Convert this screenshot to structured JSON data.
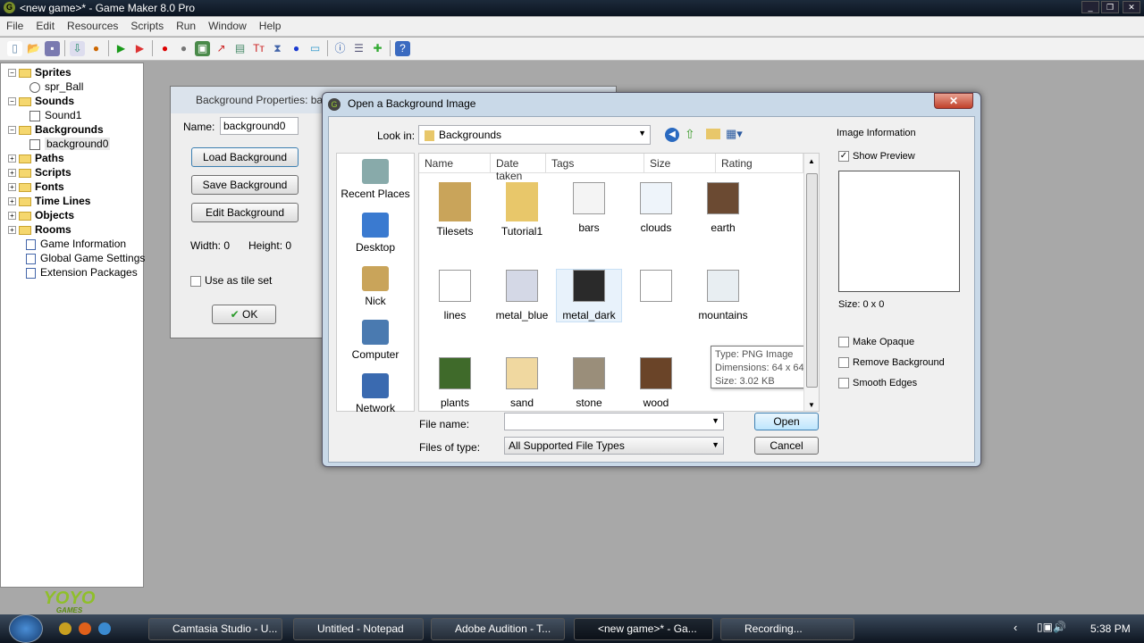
{
  "window": {
    "title": "<new game>* - Game Maker 8.0 Pro"
  },
  "menu": [
    "File",
    "Edit",
    "Resources",
    "Scripts",
    "Run",
    "Window",
    "Help"
  ],
  "toolbar": [
    "new-file",
    "open-file",
    "save",
    "create-executable",
    "publish",
    "run",
    "run-debug",
    "add-sprite",
    "add-sound",
    "add-background",
    "add-path",
    "add-script",
    "add-font",
    "add-timeline",
    "add-object",
    "add-room",
    "game-information",
    "global-settings",
    "extension-packages",
    "help"
  ],
  "tree": [
    {
      "label": "Sprites",
      "bold": true,
      "level": 0
    },
    {
      "label": "spr_Ball",
      "bold": false,
      "level": 1
    },
    {
      "label": "Sounds",
      "bold": true,
      "level": 0
    },
    {
      "label": "Sound1",
      "bold": false,
      "level": 1
    },
    {
      "label": "Backgrounds",
      "bold": true,
      "level": 0
    },
    {
      "label": "background0",
      "bold": false,
      "level": 1,
      "selected": true
    },
    {
      "label": "Paths",
      "bold": true,
      "level": 0
    },
    {
      "label": "Scripts",
      "bold": true,
      "level": 0
    },
    {
      "label": "Fonts",
      "bold": true,
      "level": 0
    },
    {
      "label": "Time Lines",
      "bold": true,
      "level": 0
    },
    {
      "label": "Objects",
      "bold": true,
      "level": 0
    },
    {
      "label": "Rooms",
      "bold": true,
      "level": 0
    },
    {
      "label": "Game Information",
      "bold": false,
      "level": 0
    },
    {
      "label": "Global Game Settings",
      "bold": false,
      "level": 0
    },
    {
      "label": "Extension Packages",
      "bold": false,
      "level": 0
    }
  ],
  "logo": {
    "text": "YOYO",
    "sub": "GAMES"
  },
  "bgprops": {
    "title": "Background Properties: ba",
    "name_label": "Name:",
    "name_value": "background0",
    "load": "Load Background",
    "save": "Save Background",
    "edit": "Edit Background",
    "width": "Width: 0",
    "height": "Height: 0",
    "tileset": "Use as tile set",
    "ok": "OK"
  },
  "dialog": {
    "title": "Open a Background Image",
    "look_in_label": "Look in:",
    "look_in_value": "Backgrounds",
    "places": [
      "Recent Places",
      "Desktop",
      "Nick",
      "Computer",
      "Network"
    ],
    "columns": [
      "Name",
      "Date taken",
      "Tags",
      "Size",
      "Rating"
    ],
    "items": [
      {
        "name": "Tilesets",
        "color": "#c9a45a"
      },
      {
        "name": "Tutorial1",
        "color": "#e8c76a"
      },
      {
        "name": "bars",
        "color": "#f4f4f4"
      },
      {
        "name": "clouds",
        "color": "#eef4fa"
      },
      {
        "name": "earth",
        "color": "#6b4a32"
      },
      {
        "name": "lines",
        "color": "#ffffff"
      },
      {
        "name": "metal_blue",
        "color": "#d4d8e6"
      },
      {
        "name": "metal_dark",
        "color": "#2a2a2a"
      },
      {
        "name": "",
        "color": "#ffffff"
      },
      {
        "name": "mountains",
        "color": "#e8eef2"
      },
      {
        "name": "plants",
        "color": "#3f6a2a"
      },
      {
        "name": "sand",
        "color": "#f0d8a0"
      },
      {
        "name": "stone",
        "color": "#9a8e7a"
      },
      {
        "name": "wood",
        "color": "#6a4428"
      }
    ],
    "tooltip": [
      "Type: PNG Image",
      "Dimensions: 64 x 64",
      "Size: 3.02 KB"
    ],
    "file_name_label": "File name:",
    "file_name_value": "",
    "file_type_label": "Files of type:",
    "file_type_value": "All Supported File Types",
    "open": "Open",
    "cancel": "Cancel",
    "info_title": "Image Information",
    "show_preview": "Show Preview",
    "show_preview_checked": true,
    "size": "Size: 0 x 0",
    "make_opaque": "Make Opaque",
    "remove_background": "Remove Background",
    "smooth_edges": "Smooth Edges"
  },
  "taskbar": {
    "tasks": [
      "Camtasia Studio - U...",
      "Untitled - Notepad",
      "Adobe Audition - T...",
      "<new game>* - Ga...",
      "Recording..."
    ],
    "active": 3,
    "clock": "5:38 PM"
  }
}
